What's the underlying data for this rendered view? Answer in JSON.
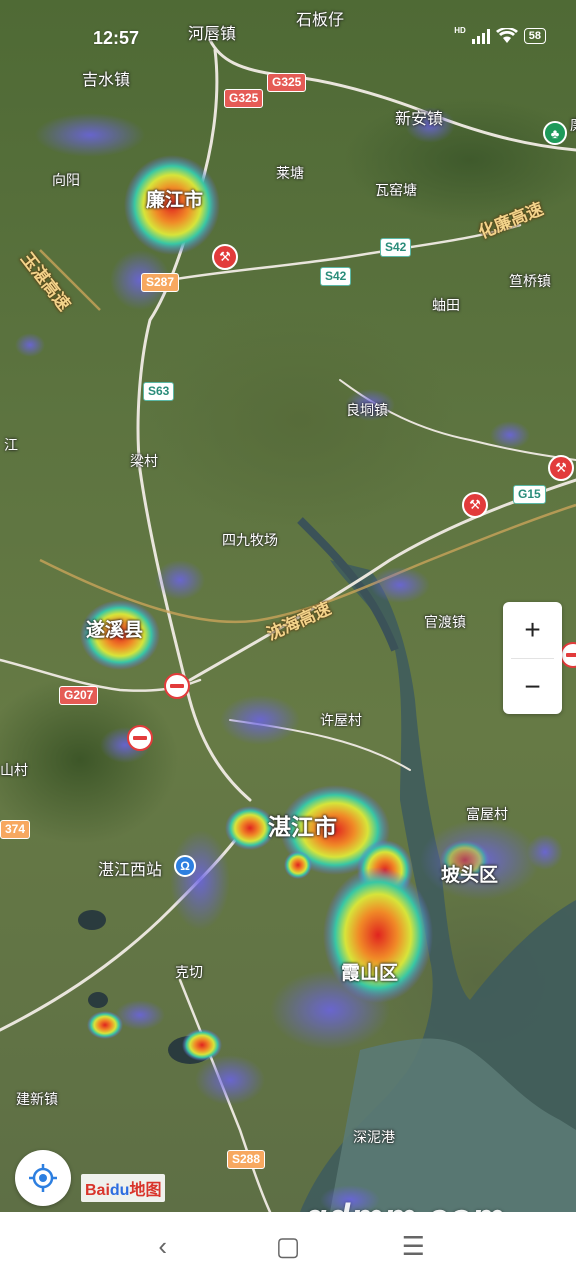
{
  "status_bar": {
    "time": "12:57",
    "battery": "58",
    "network": "HD"
  },
  "map": {
    "labels": {
      "hejiao": "河唇镇",
      "shibanzi": "石板仔",
      "jishui": "吉水镇",
      "xinan": "新安镇",
      "xiangyang": "向阳",
      "lianjiang": "廉江市",
      "caotang": "莱塘",
      "wayao": "瓦窑塘",
      "yuzhan": "玉湛高速",
      "hualian": "化廉高速",
      "zhaqiao": "笪桥镇",
      "tiantian": "蚰田",
      "liangdong": "良垌镇",
      "liangcun": "梁村",
      "jiang_left": "江",
      "simu": "四九牧场",
      "suixi": "遂溪县",
      "shenhai": "沈海高速",
      "guandu": "官渡镇",
      "xuwu": "许屋村",
      "shancun": "山村",
      "zhanjiang": "湛江市",
      "zhanjiang_west": "湛江西站",
      "potou": "坡头区",
      "fuwu": "富屋村",
      "xiashan": "霞山区",
      "kedian": "克切",
      "jianxin": "建新镇",
      "shenni": "深泥港",
      "edge_right": "廉"
    },
    "shields": {
      "g325a": "G325",
      "g325b": "G325",
      "s42a": "S42",
      "s42b": "S42",
      "s287": "S287",
      "s63": "S63",
      "g15": "G15",
      "g207": "G207",
      "s374": "374",
      "s288": "S288"
    },
    "heat_colors": [
      "#6b63e6",
      "#38c7a4",
      "#d7e43a",
      "#f08a27",
      "#e0241f"
    ]
  },
  "controls": {
    "zoom_in": "+",
    "zoom_out": "−"
  },
  "brand": {
    "logo_bai": "Bai",
    "logo_du": "du",
    "logo_cn": "地图",
    "watermark": "gdmm.com"
  },
  "nav": {
    "back": "‹",
    "home": "▢",
    "menu": "☰"
  }
}
